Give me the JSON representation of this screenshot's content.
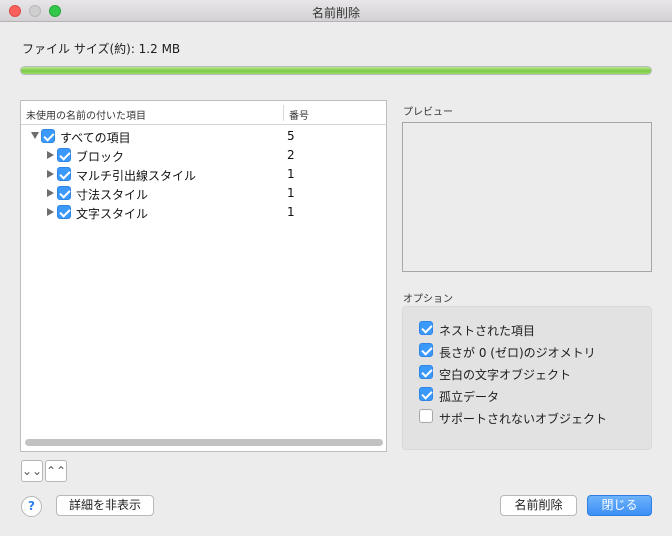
{
  "window": {
    "title": "名前削除"
  },
  "file_size": {
    "label": "ファイル サイズ(約): 1.2 MB",
    "progress": 1.0
  },
  "tree": {
    "header_name": "未使用の名前の付いた項目",
    "header_count": "番号",
    "rows": [
      {
        "label": "すべての項目",
        "count": "5",
        "expanded": true,
        "checked": true,
        "level": 0
      },
      {
        "label": "ブロック",
        "count": "2",
        "expanded": false,
        "checked": true,
        "level": 1
      },
      {
        "label": "マルチ引出線スタイル",
        "count": "1",
        "expanded": false,
        "checked": true,
        "level": 1
      },
      {
        "label": "寸法スタイル",
        "count": "1",
        "expanded": false,
        "checked": true,
        "level": 1
      },
      {
        "label": "文字スタイル",
        "count": "1",
        "expanded": false,
        "checked": true,
        "level": 1
      }
    ]
  },
  "preview": {
    "label": "プレビュー"
  },
  "options": {
    "label": "オプション",
    "items": [
      {
        "label": "ネストされた項目",
        "checked": true
      },
      {
        "label": "長さが 0 (ゼロ)のジオメトリ",
        "checked": true
      },
      {
        "label": "空白の文字オブジェクト",
        "checked": true
      },
      {
        "label": "孤立データ",
        "checked": true
      },
      {
        "label": "サポートされないオブジェクト",
        "checked": false
      }
    ]
  },
  "buttons": {
    "expand_all": "⌄⌄",
    "collapse_all": "⌃⌃",
    "help": "?",
    "hide_details": "詳細を非表示",
    "purge": "名前削除",
    "close": "閉じる"
  },
  "colors": {
    "accent": "#3b99fc",
    "progress": "#7ccb46"
  }
}
